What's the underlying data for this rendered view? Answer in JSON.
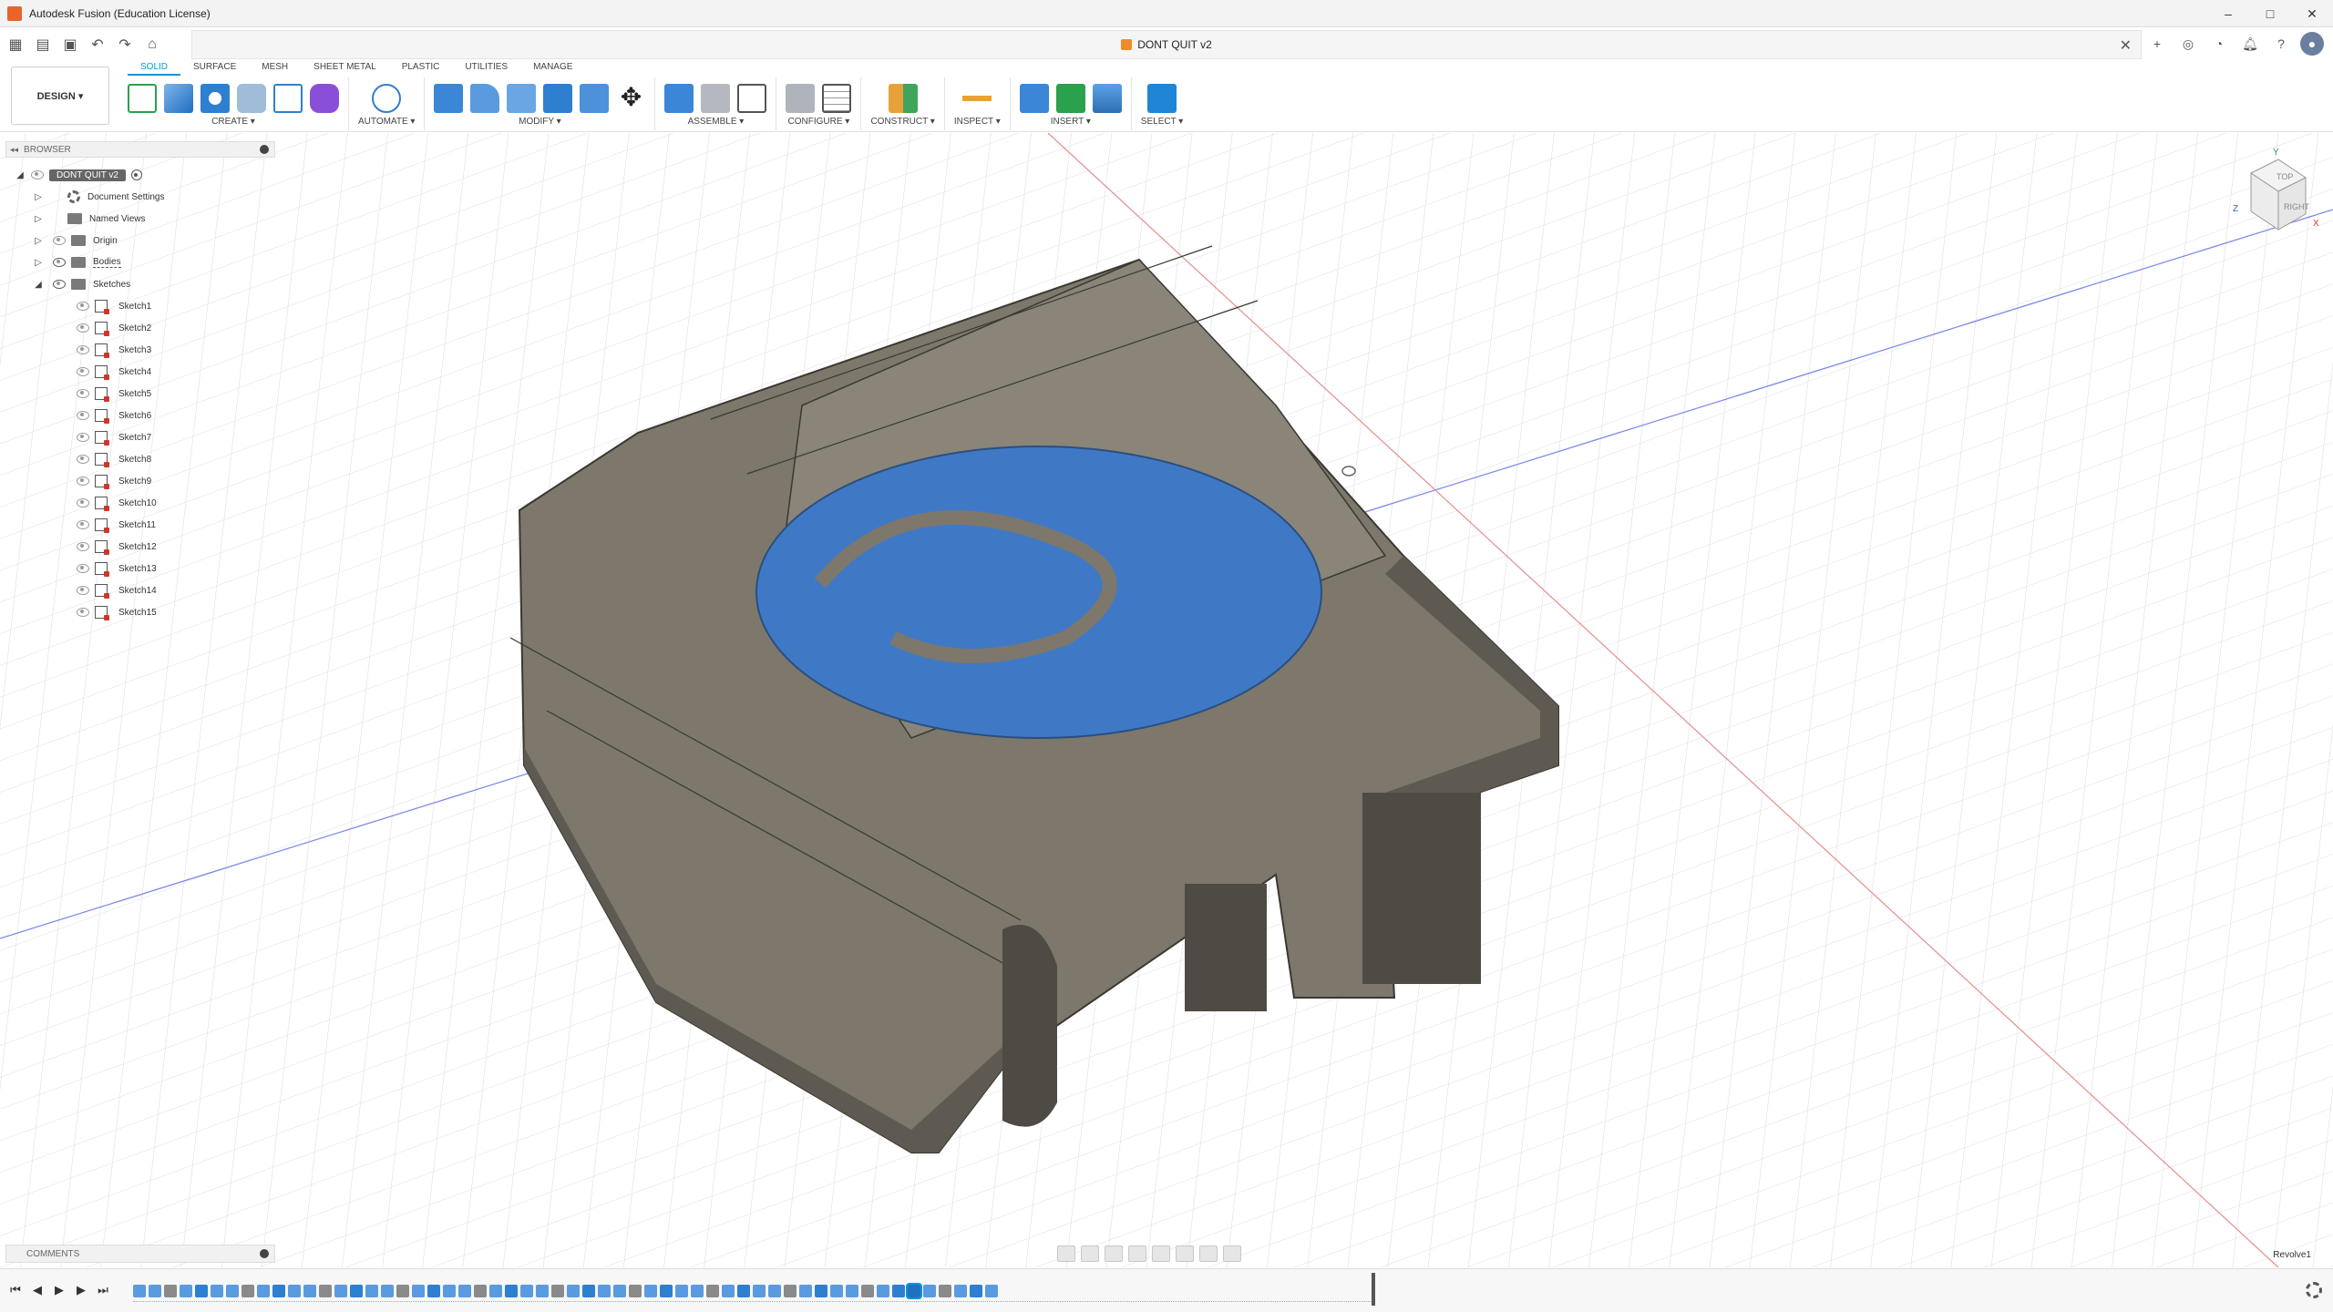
{
  "window": {
    "title": "Autodesk Fusion (Education License)",
    "controls": [
      "–",
      "□",
      "✕"
    ]
  },
  "document_tab": {
    "title": "DONT QUIT v2"
  },
  "workspace": {
    "label": "DESIGN ▾"
  },
  "tabs": [
    "SOLID",
    "SURFACE",
    "MESH",
    "SHEET METAL",
    "PLASTIC",
    "UTILITIES",
    "MANAGE"
  ],
  "active_tab": "SOLID",
  "groups": [
    {
      "label": "CREATE ▾",
      "icons": [
        "create-sketch-icon",
        "extrude-icon",
        "revolve-icon",
        "hole-icon",
        "pattern-icon",
        "form-icon"
      ]
    },
    {
      "label": "AUTOMATE ▾",
      "icons": [
        "automate-icon"
      ]
    },
    {
      "label": "MODIFY ▾",
      "icons": [
        "press-pull-icon",
        "fillet-icon",
        "chamfer-icon",
        "combine-icon",
        "shell-icon",
        "move-icon"
      ]
    },
    {
      "label": "ASSEMBLE ▾",
      "icons": [
        "new-component-icon",
        "joint-icon",
        "bom-icon"
      ]
    },
    {
      "label": "CONFIGURE ▾",
      "icons": [
        "configure-icon",
        "table-icon"
      ]
    },
    {
      "label": "CONSTRUCT ▾",
      "icons": [
        "plane-icon"
      ]
    },
    {
      "label": "INSPECT ▾",
      "icons": [
        "measure-icon"
      ]
    },
    {
      "label": "INSERT ▾",
      "icons": [
        "insert-link-icon",
        "insert-derive-icon",
        "insert-image-icon"
      ]
    },
    {
      "label": "SELECT ▾",
      "icons": [
        "select-icon"
      ]
    }
  ],
  "browser": {
    "header": "BROWSER",
    "root": "DONT QUIT v2",
    "folders": [
      "Document Settings",
      "Named Views",
      "Origin",
      "Bodies",
      "Sketches"
    ],
    "sketches": [
      "Sketch1",
      "Sketch2",
      "Sketch3",
      "Sketch4",
      "Sketch5",
      "Sketch6",
      "Sketch7",
      "Sketch8",
      "Sketch9",
      "Sketch10",
      "Sketch11",
      "Sketch12",
      "Sketch13",
      "Sketch14",
      "Sketch15"
    ]
  },
  "comments": {
    "header": "COMMENTS"
  },
  "status": {
    "current_feature": "Revolve1"
  },
  "viewcube": {
    "faces": [
      "TOP",
      "RIGHT"
    ],
    "axes": [
      "Y",
      "Z",
      "X"
    ]
  },
  "colors": {
    "accent": "#0696d7",
    "model_grey": "#7d776c",
    "logo_blue": "#3f79c6",
    "x_axis": "#e05a5a",
    "y_axis": "#5a6ee0"
  }
}
